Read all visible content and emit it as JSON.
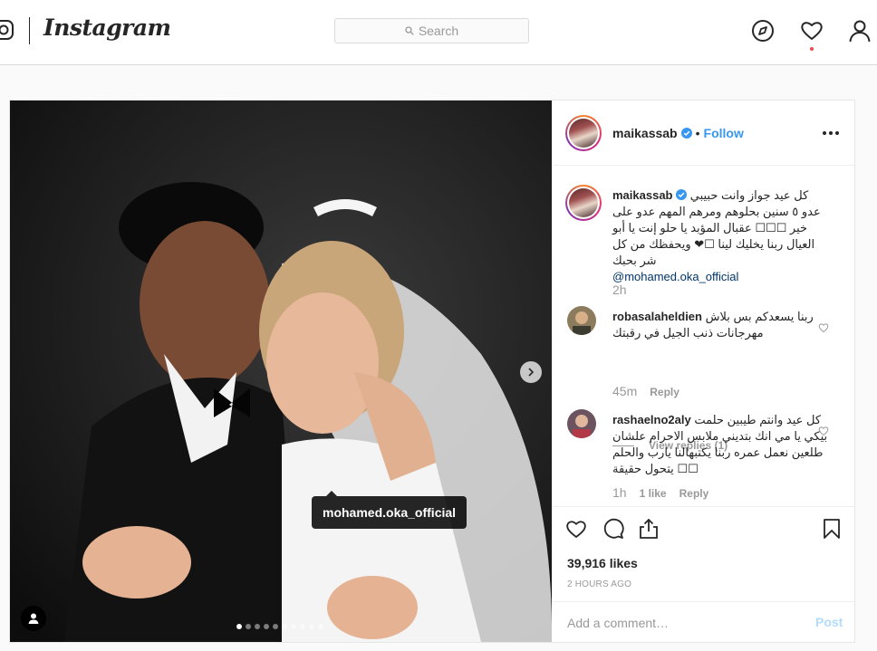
{
  "header": {
    "brand": "Instagram",
    "search_placeholder": "Search",
    "icons": [
      "instagram-camera-icon",
      "explore-compass-icon",
      "activity-heart-icon",
      "profile-person-icon"
    ],
    "accent_color": "#3897f0",
    "notification_dot_color": "#ed4956"
  },
  "post": {
    "author": "maikassab",
    "follow_label": "Follow",
    "dot_separator": "•",
    "photo_tag": "mohamed.oka_official",
    "carousel": {
      "total": 10,
      "active": 1
    },
    "caption": {
      "user": "maikassab",
      "text": "كل عيد جواز وانت حبيبي عدو ٥ سنين بحلوهم ومرهم المهم عدو على خير ☐☐☐ عقبال المؤبد يا حلو إنت يا أبو العيال ربنا يخليك لينا ☐❤ ويحفظك من كل شر بحبك",
      "mention": "@mohamed.oka_official",
      "time": "2h"
    },
    "comments": [
      {
        "user": "robasalaheldien",
        "text": "ربنا يسعدكم بس بلاش مهرجانات ذنب الجيل في رقبتك",
        "time": "45m",
        "reply_label": "Reply",
        "view_replies": "View replies (1)"
      },
      {
        "user": "rashaelno2aly",
        "text": "كل عيد وانتم طيبين حلمت بيكي يا مي انك بتديني ملابس الاحرام علشان طلعين نعمل عمره ربنا يكتبهالنا يارب والحلم يتحول حقيقة ☐☐",
        "time": "1h",
        "likes": "1 like",
        "reply_label": "Reply"
      }
    ],
    "likes_text": "39,916 likes",
    "posted_ago": "2 HOURS AGO",
    "add_comment_placeholder": "Add a comment…",
    "post_button": "Post"
  }
}
